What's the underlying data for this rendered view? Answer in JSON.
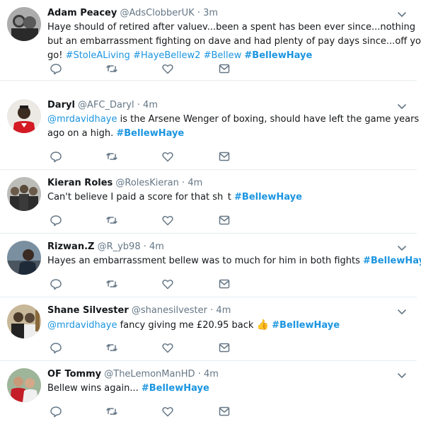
{
  "colors": {
    "text": "#14171a",
    "secondary": "#657786",
    "link": "#1b95e0",
    "divider": "#e6ecf0",
    "icon": "#657786"
  },
  "tweets": [
    {
      "name": "Adam Peacey",
      "handle": "@AdsClobberUK",
      "dot": "·",
      "time": "3m",
      "lines": [
        [
          {
            "t": "Haye should of retired after valuev...been a spent has been ever since...nothing"
          }
        ],
        [
          {
            "t": "but an embarrassment fighting on dave and had plenty of pay days since...off you"
          }
        ],
        [
          {
            "t": "go! "
          },
          {
            "t": "#StoleALiving",
            "c": "link"
          },
          {
            "t": " "
          },
          {
            "t": "#HayeBellew2",
            "c": "link"
          },
          {
            "t": " "
          },
          {
            "t": "#Bellew",
            "c": "link"
          },
          {
            "t": " "
          },
          {
            "t": "#BellewHaye",
            "c": "hashtag-bold"
          }
        ]
      ],
      "avatar_icon": "avatar-photo-two-men"
    },
    {
      "name": "Daryl",
      "handle": "@AFC_Daryl",
      "dot": "·",
      "time": "4m",
      "lines": [
        [
          {
            "t": "@mrdavidhaye",
            "c": "link"
          },
          {
            "t": " is the Arsene Wenger of boxing, should have left the game years"
          }
        ],
        [
          {
            "t": "ago on a high. "
          },
          {
            "t": "#BellewHaye",
            "c": "hashtag-bold"
          }
        ]
      ],
      "avatar_icon": "avatar-photo-arsenal-player"
    },
    {
      "name": "Kieran Roles",
      "handle": "@RolesKieran",
      "dot": "·",
      "time": "4m",
      "lines": [
        [
          {
            "t": "Can't believe I paid a score for that sh"
          },
          {
            "t": " "
          },
          {
            "t": "t "
          },
          {
            "t": "#BellewHaye",
            "c": "hashtag-bold"
          }
        ]
      ],
      "avatar_icon": "avatar-photo-group"
    },
    {
      "name": "Rizwan.Z",
      "handle": "@R_yb98",
      "dot": "·",
      "time": "4m",
      "lines": [
        [
          {
            "t": "Hayes an embarrassment bellew was to much for him in both fights "
          },
          {
            "t": "#BellewHaye",
            "c": "hashtag-bold"
          }
        ]
      ],
      "avatar_icon": "avatar-photo-man-seated"
    },
    {
      "name": "Shane Silvester",
      "handle": "@shanesilvester",
      "dot": "·",
      "time": "4m",
      "lines": [
        [
          {
            "t": "@mrdavidhaye",
            "c": "link"
          },
          {
            "t": " fancy giving me £20.95 back "
          },
          {
            "t": "👍",
            "c": "emoji"
          },
          {
            "t": " "
          },
          {
            "t": "#BellewHaye",
            "c": "hashtag-bold"
          }
        ]
      ],
      "avatar_icon": "avatar-photo-men-at-party"
    },
    {
      "name": "OF Tommy",
      "handle": "@TheLemonManHD",
      "dot": "·",
      "time": "4m",
      "lines": [
        [
          {
            "t": "Bellew wins again... "
          },
          {
            "t": "#BellewHaye",
            "c": "hashtag-bold"
          }
        ]
      ],
      "avatar_icon": "avatar-photo-two-friends"
    }
  ],
  "action_icons": [
    "reply-icon",
    "retweet-icon",
    "like-icon",
    "direct-message-icon"
  ],
  "menu_icon": "chevron-down-icon"
}
